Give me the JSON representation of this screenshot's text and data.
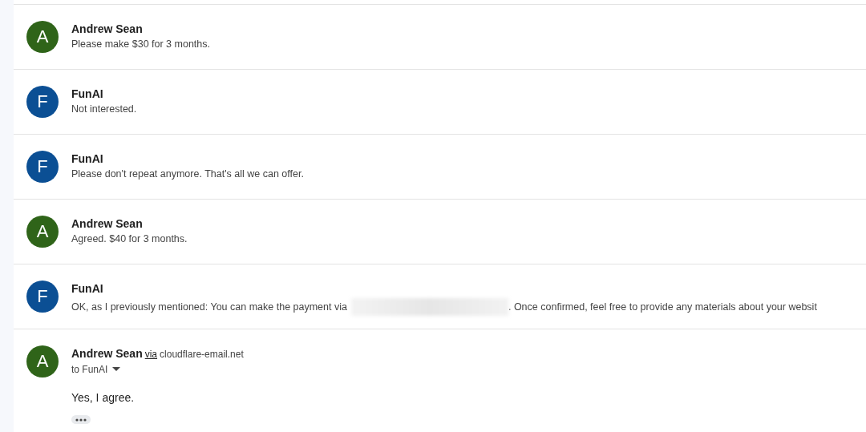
{
  "messages": [
    {
      "kind": "collapsed",
      "initial": "A",
      "color": "#2f6419",
      "sender": "Andrew Sean",
      "snippet": "Please make $30 for 3 months."
    },
    {
      "kind": "collapsed",
      "initial": "F",
      "color": "#0b4f94",
      "sender": "FunAI",
      "snippet": "Not interested."
    },
    {
      "kind": "collapsed",
      "initial": "F",
      "color": "#0b4f94",
      "sender": "FunAI",
      "snippet": "Please don't repeat anymore. That's all we can offer."
    },
    {
      "kind": "collapsed",
      "initial": "A",
      "color": "#2f6419",
      "sender": "Andrew Sean",
      "snippet": "Agreed. $40 for 3 months."
    },
    {
      "kind": "collapsed",
      "initial": "F",
      "color": "#0b4f94",
      "sender": "FunAI",
      "snippet": "OK, as I previously mentioned: You can make the payment via",
      "redacted": true,
      "snippet_after": ". Once confirmed, feel free to provide any materials about your websit"
    },
    {
      "kind": "expanded",
      "initial": "A",
      "color": "#2f6419",
      "sender": "Andrew Sean",
      "via_label": "via",
      "via_domain": "cloudflare-email.net",
      "recipients": "to FunAI",
      "body": "Yes, I agree."
    }
  ]
}
